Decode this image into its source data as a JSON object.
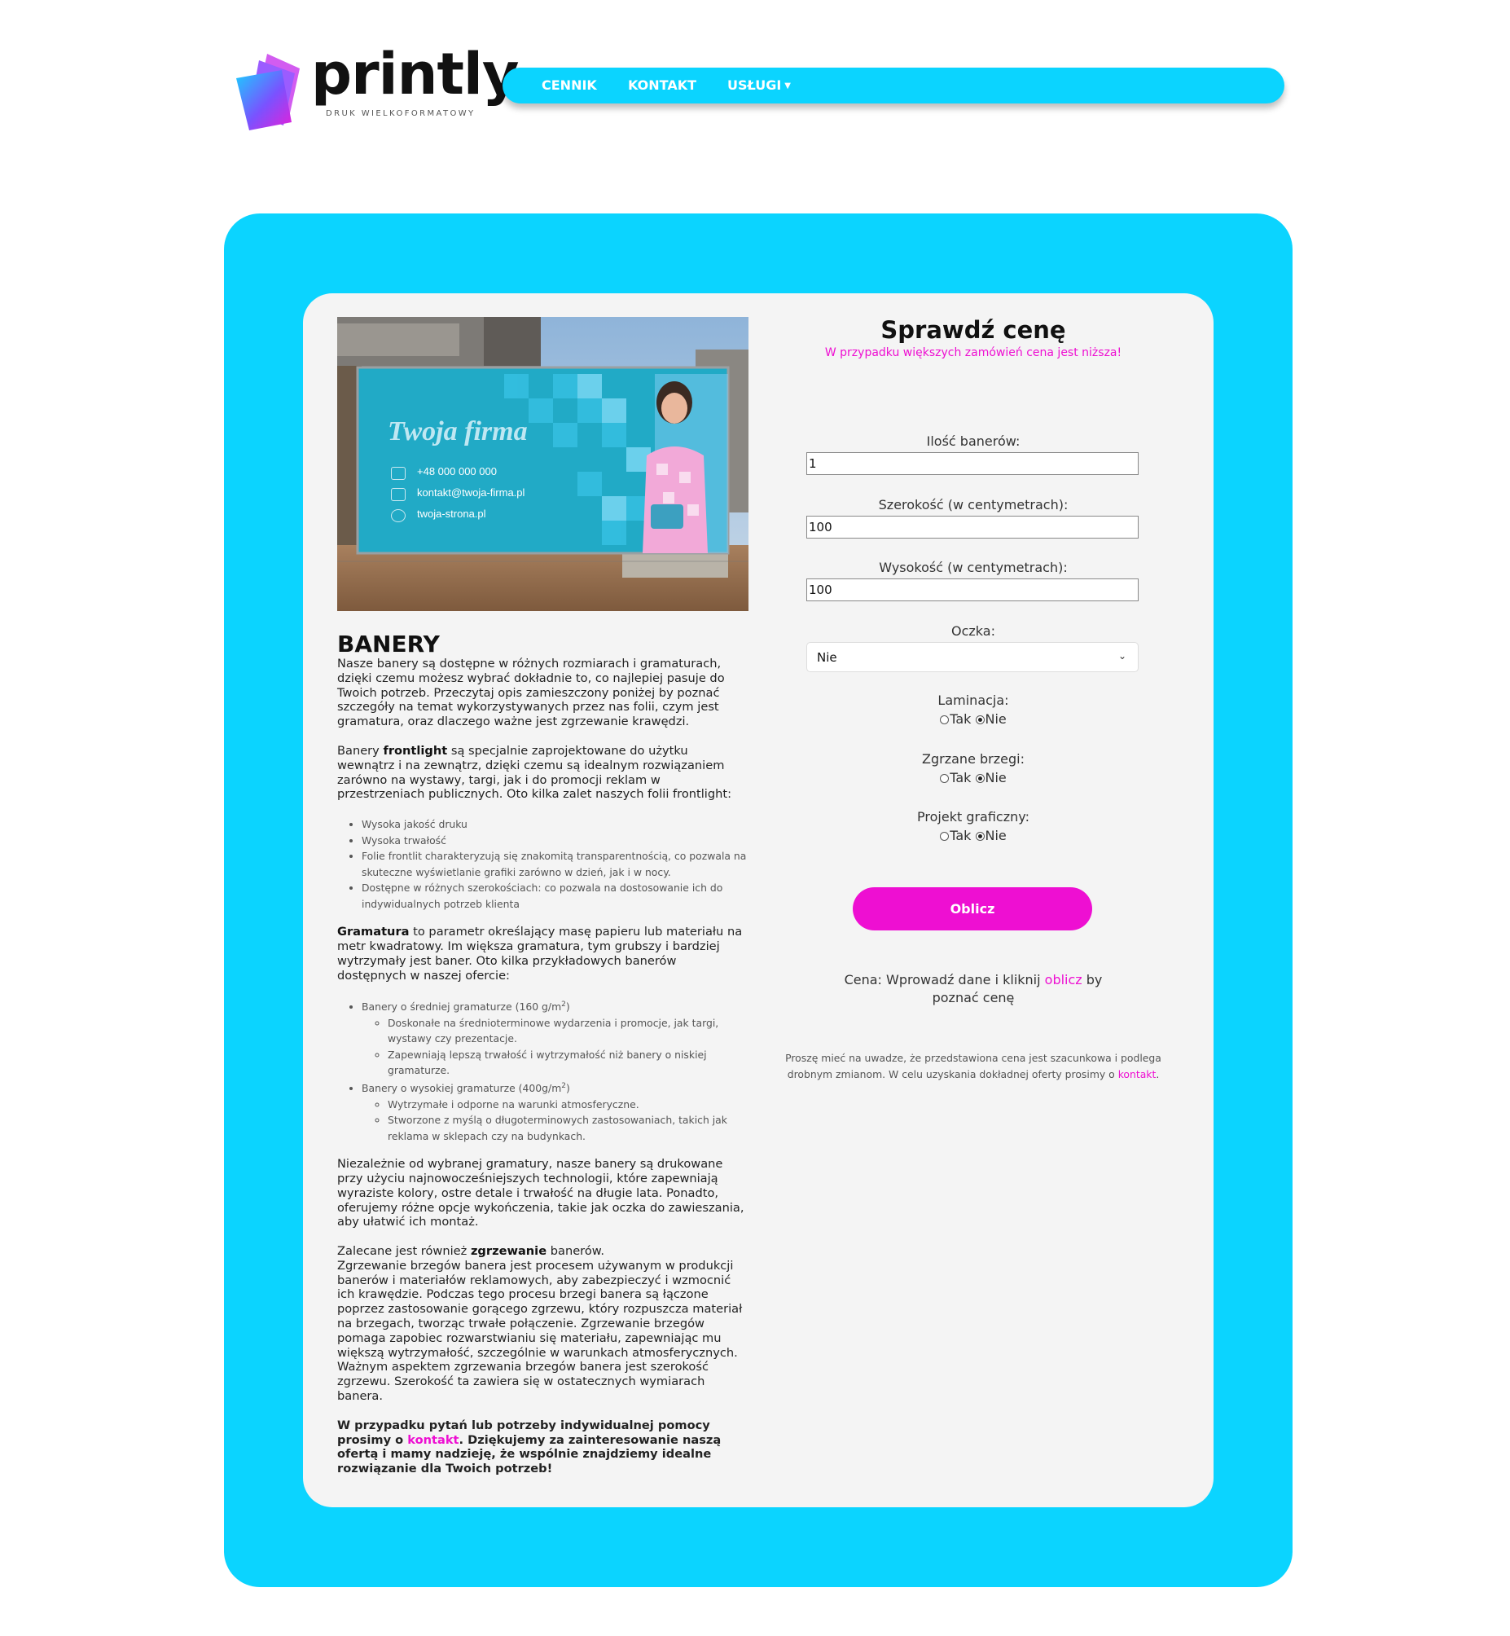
{
  "header": {
    "brand": "printly",
    "tagline": "DRUK WIELKOFORMATOWY",
    "nav": {
      "cennik": "CENNIK",
      "kontakt": "KONTAKT",
      "uslugi": "USŁUGI"
    }
  },
  "banner_image": {
    "title": "Twoja firma",
    "phone": "+48 000 000 000",
    "email": "kontakt@twoja-firma.pl",
    "web": "twoja-strona.pl"
  },
  "article": {
    "heading": "BANERY",
    "intro": "Nasze banery są dostępne w różnych rozmiarach i gramaturach, dzięki czemu możesz wybrać dokładnie to, co najlepiej pasuje do Twoich potrzeb. Przeczytaj opis zamieszczony poniżej by poznać szczegóły na temat wykorzystywanych przez nas folii, czym jest gramatura, oraz dlaczego ważne jest zgrzewanie krawędzi.",
    "frontlight_pre": "Banery ",
    "frontlight_kw": "frontlight",
    "frontlight_post": " są specjalnie zaprojektowane do użytku wewnątrz i na zewnątrz, dzięki czemu są idealnym rozwiązaniem zarówno na wystawy, targi, jak i do promocji reklam w przestrzeniach publicznych. Oto kilka zalet naszych folii frontlight:",
    "frontlight_list": [
      "Wysoka jakość druku",
      "Wysoka trwałość",
      "Folie frontlit charakteryzują się znakomitą transparentnością, co pozwala na skuteczne wyświetlanie grafiki zarówno w dzień, jak i w nocy.",
      "Dostępne w różnych szerokościach: co pozwala na dostosowanie ich do indywidualnych potrzeb klienta"
    ],
    "gramatura_kw": "Gramatura",
    "gramatura_post": " to parametr określający masę papieru lub materiału na metr kwadratowy. Im większa gramatura, tym grubszy i bardziej wytrzymały jest baner. Oto kilka przykładowych banerów dostępnych w naszej ofercie:",
    "g1_pre": "Banery o średniej gramaturze (160 g/m",
    "g1_sup": "2",
    "g1_post": ")",
    "g1_items": [
      "Doskonałe na średnioterminowe wydarzenia i promocje, jak targi, wystawy czy prezentacje.",
      "Zapewniają lepszą trwałość i wytrzymałość niż banery o niskiej gramaturze."
    ],
    "g2_pre": "Banery o wysokiej gramaturze (400g/m",
    "g2_sup": "2",
    "g2_post": ")",
    "g2_items": [
      "Wytrzymałe i odporne na warunki atmosferyczne.",
      "Stworzone z myślą o długoterminowych zastosowaniach, takich jak reklama w sklepach czy na budynkach."
    ],
    "print_para": "Niezależnie od wybranej gramatury, nasze banery są drukowane przy użyciu najnowocześniejszych technologii, które zapewniają wyraziste kolory, ostre detale i trwałość na długie lata. Ponadto, oferujemy różne opcje wykończenia, takie jak oczka do zawieszania, aby ułatwić ich montaż.",
    "weld_pre": "Zalecane jest również ",
    "weld_kw": "zgrzewanie",
    "weld_post": " banerów.",
    "weld_para": "Zgrzewanie brzegów banera jest procesem używanym w produkcji banerów i materiałów reklamowych, aby zabezpieczyć i wzmocnić ich krawędzie. Podczas tego procesu brzegi banera są łączone poprzez zastosowanie gorącego zgrzewu, który rozpuszcza materiał na brzegach, tworząc trwałe połączenie. Zgrzewanie brzegów pomaga zapobiec rozwarstwianiu się materiału, zapewniając mu większą wytrzymałość, szczególnie w warunkach atmosferycznych. Ważnym aspektem zgrzewania brzegów banera jest szerokość zgrzewu. Szerokość ta zawiera się w ostatecznych wymiarach banera.",
    "closing_pre": "W przypadku pytań lub potrzeby indywidualnej pomocy prosimy o ",
    "closing_link": "kontakt",
    "closing_post": ". Dziękujemy za zainteresowanie naszą ofertą i mamy nadzieję, że wspólnie znajdziemy idealne rozwiązanie dla Twoich potrzeb!"
  },
  "calculator": {
    "title": "Sprawdź cenę",
    "subtitle": "W przypadku większych zamówień cena jest niższa!",
    "qty_label": "Ilość banerów:",
    "qty_value": "1",
    "width_label": "Szerokość (w centymetrach):",
    "width_value": "100",
    "height_label": "Wysokość (w centymetrach):",
    "height_value": "100",
    "eyelets_label": "Oczka:",
    "eyelets_value": "Nie",
    "lamination_label": "Laminacja:",
    "welded_label": "Zgrzane brzegi:",
    "design_label": "Projekt graficzny:",
    "opt_yes": "Tak",
    "opt_no": "Nie",
    "button": "Oblicz",
    "price_pre": "Cena: Wprowadź dane i kliknij ",
    "price_link": "oblicz",
    "price_post": " by poznać cenę",
    "note_pre": "Proszę mieć na uwadze, że przedstawiona cena jest szacunkowa i podlega drobnym zmianom. W celu uzyskania dokładnej oferty prosimy o ",
    "note_link": "kontakt",
    "note_post": "."
  },
  "colors": {
    "accent": "#0bd4ff",
    "pink": "#ee0fd2",
    "panel": "#f4f4f4"
  }
}
